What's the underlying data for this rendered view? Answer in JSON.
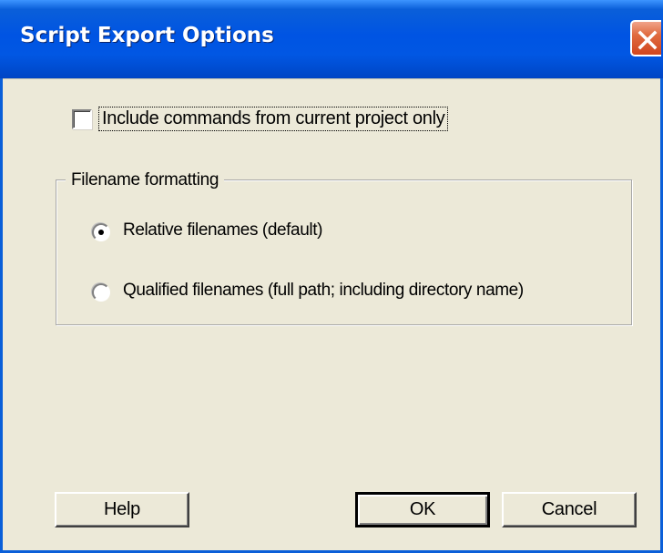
{
  "dialog": {
    "title": "Script Export Options",
    "close_icon": "close-icon"
  },
  "options": {
    "current_project_only": {
      "label": "Include commands from current project only",
      "checked": false
    }
  },
  "filename_formatting": {
    "legend": "Filename formatting",
    "selected": "relative",
    "items": [
      {
        "id": "relative",
        "label": "Relative filenames (default)",
        "selected": true
      },
      {
        "id": "qualified",
        "label": "Qualified filenames (full path; including directory name)",
        "selected": false
      }
    ]
  },
  "buttons": {
    "help": "Help",
    "ok": "OK",
    "cancel": "Cancel"
  }
}
